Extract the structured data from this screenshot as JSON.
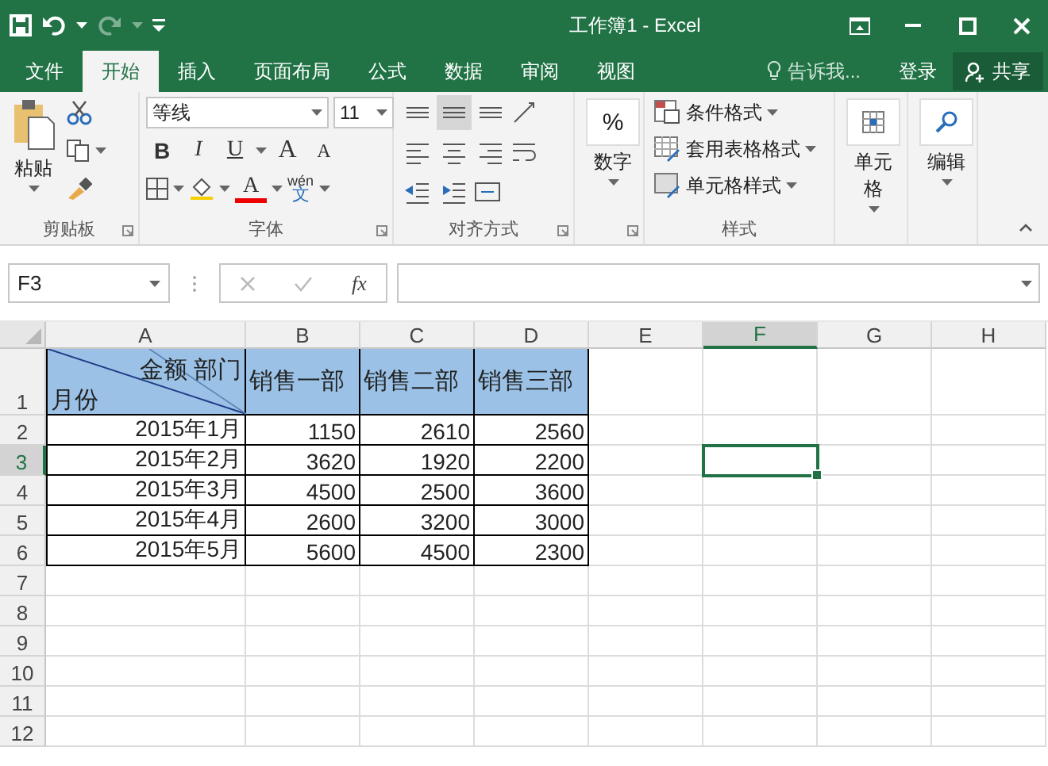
{
  "title_bar": {
    "title": "工作簿1 - Excel",
    "redo_disabled": true
  },
  "tabs": [
    {
      "label": "文件",
      "selected": false
    },
    {
      "label": "开始",
      "selected": true
    },
    {
      "label": "插入",
      "selected": false
    },
    {
      "label": "页面布局",
      "selected": false
    },
    {
      "label": "公式",
      "selected": false
    },
    {
      "label": "数据",
      "selected": false
    },
    {
      "label": "审阅",
      "selected": false
    },
    {
      "label": "视图",
      "selected": false
    }
  ],
  "tell_me": {
    "placeholder": "告诉我..."
  },
  "sign_in": "登录",
  "share": "共享",
  "ribbon": {
    "clipboard": {
      "paste": "粘贴",
      "label": "剪贴板"
    },
    "font": {
      "name": "等线",
      "size": "11",
      "style_buttons": [
        "B",
        "I",
        "U"
      ],
      "size_buttons": [
        "A",
        "A"
      ],
      "color_button": "A",
      "phonetic": {
        "reading": "wén",
        "character": "文"
      },
      "label": "字体"
    },
    "alignment": {
      "label": "对齐方式",
      "buttons": [
        {
          "kind": "top",
          "selected": false
        },
        {
          "kind": "middle",
          "selected": true
        },
        {
          "kind": "bottom",
          "selected": false
        },
        {
          "kind": "left",
          "selected": false
        },
        {
          "kind": "center",
          "selected": false
        },
        {
          "kind": "right",
          "selected": false
        },
        {
          "kind": "outdent",
          "selected": false
        },
        {
          "kind": "indent",
          "selected": false
        }
      ]
    },
    "number": {
      "symbol": "%",
      "button": "数字"
    },
    "styles": {
      "buttons": [
        "条件格式",
        "套用表格格式",
        "单元格样式"
      ],
      "label": "样式"
    },
    "cells": {
      "button": "单元格"
    },
    "editing": {
      "button": "编辑"
    }
  },
  "formula_bar": {
    "name_box": "F3",
    "function_label": "fx"
  },
  "sheet": {
    "columns": [
      {
        "label": "A",
        "selected": false
      },
      {
        "label": "B",
        "selected": false
      },
      {
        "label": "C",
        "selected": false
      },
      {
        "label": "D",
        "selected": false
      },
      {
        "label": "E",
        "selected": false
      },
      {
        "label": "F",
        "selected": true
      },
      {
        "label": "G",
        "selected": false
      },
      {
        "label": "H",
        "selected": false
      }
    ],
    "rows": [
      {
        "number": "1",
        "selected": false,
        "kind": "header",
        "cells": [
          {
            "kind": "split",
            "top": "金额 部门",
            "bottom": "月份"
          },
          {
            "kind": "text",
            "text": "销售一部"
          },
          {
            "kind": "text",
            "text": "销售二部"
          },
          {
            "kind": "text",
            "text": "销售三部"
          }
        ]
      },
      {
        "number": "2",
        "selected": false,
        "kind": "data",
        "cells": [
          {
            "kind": "text",
            "text": "2015年1月"
          },
          {
            "kind": "text",
            "text": "1150"
          },
          {
            "kind": "text",
            "text": "2610"
          },
          {
            "kind": "text",
            "text": "2560"
          }
        ]
      },
      {
        "number": "3",
        "selected": true,
        "kind": "data",
        "cells": [
          {
            "kind": "text",
            "text": "2015年2月"
          },
          {
            "kind": "text",
            "text": "3620"
          },
          {
            "kind": "text",
            "text": "1920"
          },
          {
            "kind": "text",
            "text": "2200"
          }
        ]
      },
      {
        "number": "4",
        "selected": false,
        "kind": "data",
        "cells": [
          {
            "kind": "text",
            "text": "2015年3月"
          },
          {
            "kind": "text",
            "text": "4500"
          },
          {
            "kind": "text",
            "text": "2500"
          },
          {
            "kind": "text",
            "text": "3600"
          }
        ]
      },
      {
        "number": "5",
        "selected": false,
        "kind": "data",
        "cells": [
          {
            "kind": "text",
            "text": "2015年4月"
          },
          {
            "kind": "text",
            "text": "2600"
          },
          {
            "kind": "text",
            "text": "3200"
          },
          {
            "kind": "text",
            "text": "3000"
          }
        ]
      },
      {
        "number": "6",
        "selected": false,
        "kind": "data",
        "cells": [
          {
            "kind": "text",
            "text": "2015年5月"
          },
          {
            "kind": "text",
            "text": "5600"
          },
          {
            "kind": "text",
            "text": "4500"
          },
          {
            "kind": "text",
            "text": "2300"
          }
        ]
      },
      {
        "number": "7",
        "selected": false,
        "kind": "data"
      },
      {
        "number": "8",
        "selected": false,
        "kind": "data"
      },
      {
        "number": "9",
        "selected": false,
        "kind": "data"
      },
      {
        "number": "10",
        "selected": false,
        "kind": "data"
      },
      {
        "number": "11",
        "selected": false,
        "kind": "data"
      },
      {
        "number": "12",
        "selected": false,
        "kind": "data"
      }
    ]
  }
}
